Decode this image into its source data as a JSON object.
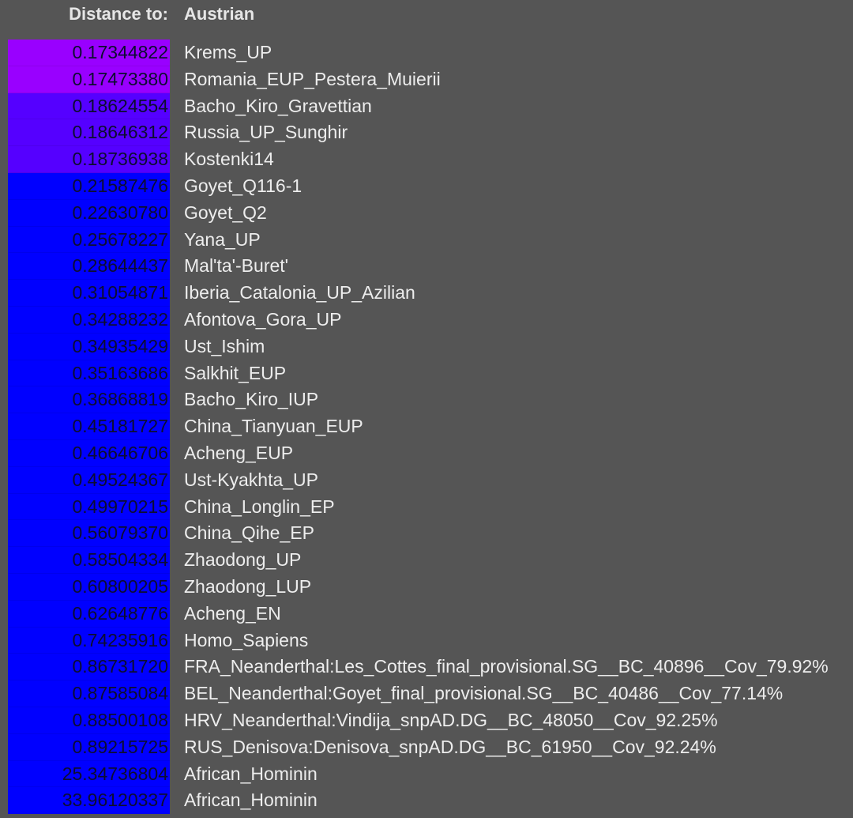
{
  "header": {
    "label": "Distance to:",
    "target": "Austrian"
  },
  "colors": {
    "background": "#555555",
    "text": "#ededed",
    "distance_text": "#0d0d30",
    "tier_violet": "#9900ff",
    "tier_indigo": "#5500ff",
    "tier_blue": "#0000ff"
  },
  "rows": [
    {
      "distance": "0.17344822",
      "name": "Krems_UP",
      "color": "#9900ff"
    },
    {
      "distance": "0.17473380",
      "name": "Romania_EUP_Pestera_Muierii",
      "color": "#9900ff"
    },
    {
      "distance": "0.18624554",
      "name": "Bacho_Kiro_Gravettian",
      "color": "#5500ff"
    },
    {
      "distance": "0.18646312",
      "name": "Russia_UP_Sunghir",
      "color": "#5500ff"
    },
    {
      "distance": "0.18736938",
      "name": "Kostenki14",
      "color": "#5500ff"
    },
    {
      "distance": "0.21587476",
      "name": "Goyet_Q116-1",
      "color": "#0000ff"
    },
    {
      "distance": "0.22630780",
      "name": "Goyet_Q2",
      "color": "#0000ff"
    },
    {
      "distance": "0.25678227",
      "name": "Yana_UP",
      "color": "#0000ff"
    },
    {
      "distance": "0.28644437",
      "name": "Mal'ta'-Buret'",
      "color": "#0000ff"
    },
    {
      "distance": "0.31054871",
      "name": "Iberia_Catalonia_UP_Azilian",
      "color": "#0000ff"
    },
    {
      "distance": "0.34288232",
      "name": "Afontova_Gora_UP",
      "color": "#0000ff"
    },
    {
      "distance": "0.34935429",
      "name": "Ust_Ishim",
      "color": "#0000ff"
    },
    {
      "distance": "0.35163686",
      "name": "Salkhit_EUP",
      "color": "#0000ff"
    },
    {
      "distance": "0.36868819",
      "name": "Bacho_Kiro_IUP",
      "color": "#0000ff"
    },
    {
      "distance": "0.45181727",
      "name": "China_Tianyuan_EUP",
      "color": "#0000ff"
    },
    {
      "distance": "0.46646706",
      "name": "Acheng_EUP",
      "color": "#0000ff"
    },
    {
      "distance": "0.49524367",
      "name": "Ust-Kyakhta_UP",
      "color": "#0000ff"
    },
    {
      "distance": "0.49970215",
      "name": "China_Longlin_EP",
      "color": "#0000ff"
    },
    {
      "distance": "0.56079370",
      "name": "China_Qihe_EP",
      "color": "#0000ff"
    },
    {
      "distance": "0.58504334",
      "name": "Zhaodong_UP",
      "color": "#0000ff"
    },
    {
      "distance": "0.60800205",
      "name": "Zhaodong_LUP",
      "color": "#0000ff"
    },
    {
      "distance": "0.62648776",
      "name": "Acheng_EN",
      "color": "#0000ff"
    },
    {
      "distance": "0.74235916",
      "name": "Homo_Sapiens",
      "color": "#0000ff"
    },
    {
      "distance": "0.86731720",
      "name": "FRA_Neanderthal:Les_Cottes_final_provisional.SG__BC_40896__Cov_79.92%",
      "color": "#0000ff"
    },
    {
      "distance": "0.87585084",
      "name": "BEL_Neanderthal:Goyet_final_provisional.SG__BC_40486__Cov_77.14%",
      "color": "#0000ff"
    },
    {
      "distance": "0.88500108",
      "name": "HRV_Neanderthal:Vindija_snpAD.DG__BC_48050__Cov_92.25%",
      "color": "#0000ff"
    },
    {
      "distance": "0.89215725",
      "name": "RUS_Denisova:Denisova_snpAD.DG__BC_61950__Cov_92.24%",
      "color": "#0000ff"
    },
    {
      "distance": "25.34736804",
      "name": "African_Hominin",
      "color": "#0000ff"
    },
    {
      "distance": "33.96120337",
      "name": "African_Hominin",
      "color": "#0000ff"
    }
  ]
}
